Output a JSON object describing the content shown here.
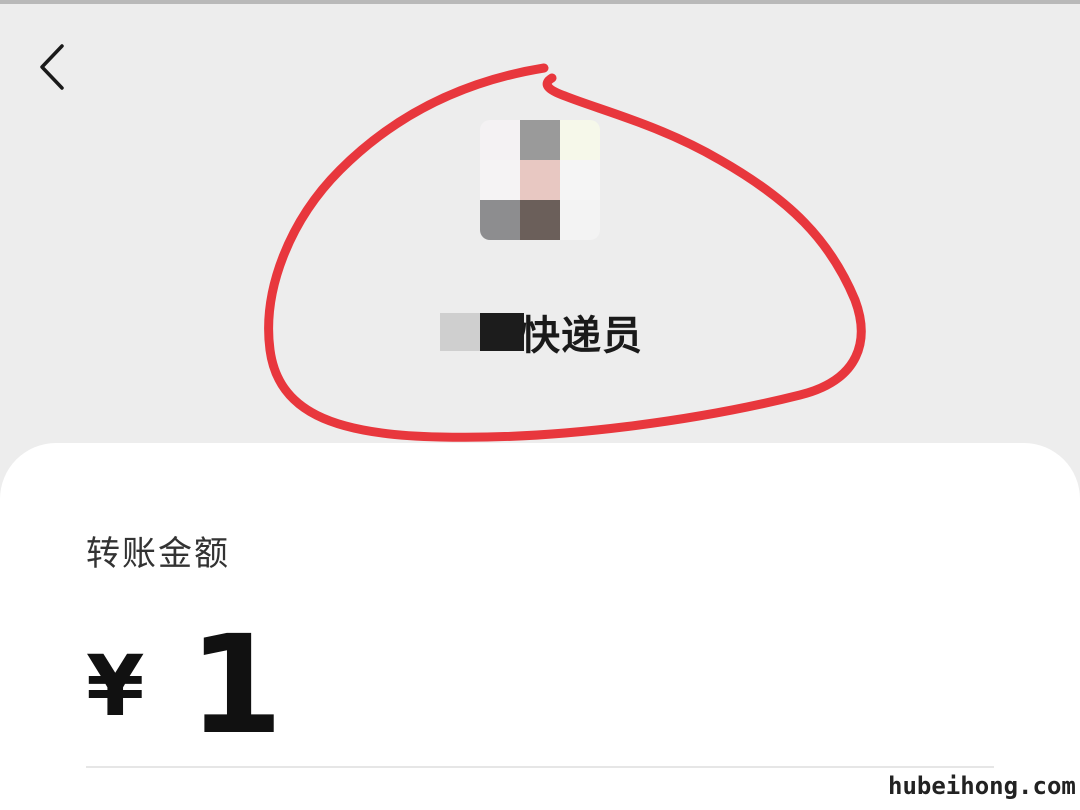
{
  "header": {
    "back_icon": "chevron-left-icon",
    "payee": {
      "name": "快递员"
    }
  },
  "transfer": {
    "amount_label": "转账金额",
    "currency_symbol": "¥",
    "amount": "1"
  },
  "watermark": "hubeihong.com",
  "colors": {
    "header_bg": "#ededed",
    "card_bg": "#ffffff",
    "annotation_red": "#e8373d",
    "text_primary": "#111111"
  }
}
